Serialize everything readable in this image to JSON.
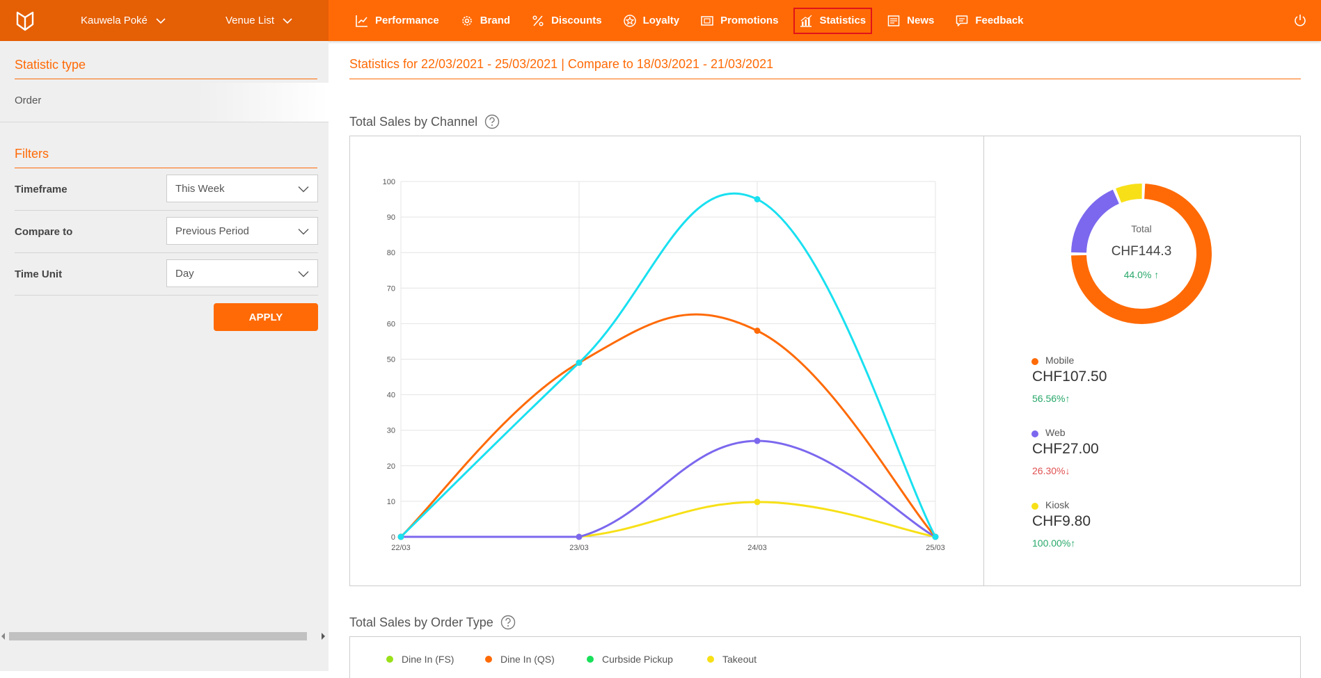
{
  "header": {
    "venue_name": "Kauwela Poké",
    "venue_list_label": "Venue List",
    "nav": [
      {
        "label": "Performance",
        "icon": "chart-line-icon"
      },
      {
        "label": "Brand",
        "icon": "gear-icon"
      },
      {
        "label": "Discounts",
        "icon": "percent-icon"
      },
      {
        "label": "Loyalty",
        "icon": "star-icon"
      },
      {
        "label": "Promotions",
        "icon": "promotion-icon"
      },
      {
        "label": "Statistics",
        "icon": "bar-chart-icon",
        "active": true
      },
      {
        "label": "News",
        "icon": "news-icon"
      },
      {
        "label": "Feedback",
        "icon": "feedback-icon"
      }
    ]
  },
  "sidebar": {
    "statistic_type_title": "Statistic type",
    "statistic_type_value": "Order",
    "filters_title": "Filters",
    "filters": [
      {
        "label": "Timeframe",
        "value": "This Week"
      },
      {
        "label": "Compare to",
        "value": "Previous Period"
      },
      {
        "label": "Time Unit",
        "value": "Day"
      }
    ],
    "apply_label": "APPLY"
  },
  "main": {
    "title": "Statistics for 22/03/2021 - 25/03/2021 | Compare to 18/03/2021 - 21/03/2021",
    "sales_by_channel_title": "Total Sales by Channel",
    "sales_by_order_type_title": "Total Sales by Order Type",
    "donut": {
      "label": "Total",
      "value": "CHF144.3",
      "change": "44.0% ↑"
    },
    "channel_legend": [
      {
        "name": "Mobile",
        "value": "CHF107.50",
        "change": "56.56%↑",
        "color": "#ff6a06",
        "change_color": "#28a86a"
      },
      {
        "name": "Web",
        "value": "CHF27.00",
        "change": "26.30%↓",
        "color": "#7b68ee",
        "change_color": "#e05050"
      },
      {
        "name": "Kiosk",
        "value": "CHF9.80",
        "change": "100.00%↑",
        "color": "#f7e017",
        "change_color": "#28a86a"
      }
    ],
    "order_type_legend": [
      {
        "name": "Dine In (FS)",
        "color": "#9ae01a"
      },
      {
        "name": "Dine In (QS)",
        "color": "#ff6a06"
      },
      {
        "name": "Curbside Pickup",
        "color": "#19e05a"
      },
      {
        "name": "Takeout",
        "color": "#f7e017"
      }
    ]
  },
  "chart_data": [
    {
      "type": "line",
      "x": [
        "22/03",
        "23/03",
        "24/03",
        "25/03"
      ],
      "ylim": [
        0,
        100
      ],
      "yticks": [
        0,
        10,
        20,
        30,
        40,
        50,
        60,
        70,
        80,
        90,
        100
      ],
      "grid": true,
      "series": [
        {
          "values": [
            0,
            49,
            95,
            0
          ],
          "color": "#19e0f0"
        },
        {
          "values": [
            0,
            49,
            58,
            0
          ],
          "color": "#ff6a06"
        },
        {
          "values": [
            0,
            0,
            27,
            0
          ],
          "color": "#7b68ee"
        },
        {
          "values": [
            0,
            0,
            9.8,
            0
          ],
          "color": "#f7e017"
        }
      ]
    },
    {
      "type": "pie",
      "categories": [
        "Mobile",
        "Web",
        "Kiosk"
      ],
      "values": [
        107.5,
        27.0,
        9.8
      ],
      "colors": [
        "#ff6a06",
        "#7b68ee",
        "#f7e017"
      ]
    }
  ]
}
